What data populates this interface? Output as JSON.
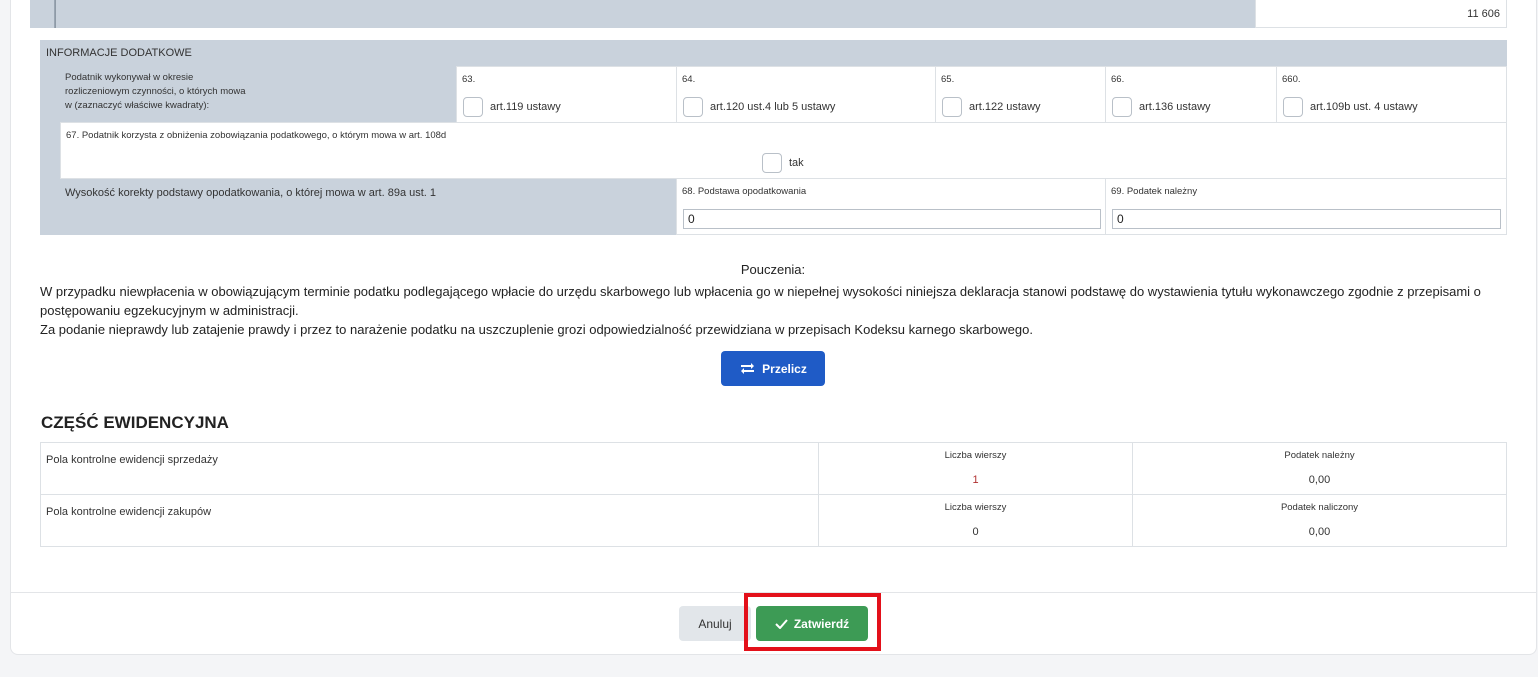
{
  "top_row": {
    "value": "11 606"
  },
  "info": {
    "header": "INFORMACJE DODATKOWE",
    "activities_label": "Podatnik wykonywał w okresie rozliczeniowym czynności, o których mowa w (zaznaczyć właściwe kwadraty):",
    "checkboxes": [
      {
        "num": "63.",
        "label": "art.119 ustawy"
      },
      {
        "num": "64.",
        "label": "art.120 ust.4 lub 5 ustawy"
      },
      {
        "num": "65.",
        "label": "art.122 ustawy"
      },
      {
        "num": "66.",
        "label": "art.136 ustawy"
      },
      {
        "num": "660.",
        "label": "art.109b ust. 4 ustawy"
      }
    ],
    "field67": {
      "label": "67. Podatnik korzysta z obniżenia zobowiązania podatkowego, o którym mowa w art. 108d",
      "option": "tak"
    },
    "correction_label": "Wysokość korekty podstawy opodatkowania, o której mowa w art. 89a ust. 1",
    "field68": {
      "label": "68. Podstawa opodatkowania",
      "value": "0"
    },
    "field69": {
      "label": "69. Podatek należny",
      "value": "0"
    }
  },
  "instructions": {
    "title": "Pouczenia:",
    "line1": "W przypadku niewpłacenia w obowiązującym terminie podatku podlegającego wpłacie do urzędu skarbowego lub wpłacenia go w niepełnej wysokości niniejsza deklaracja stanowi podstawę do wystawienia tytułu wykonawczego zgodnie z przepisami o postępowaniu egzekucyjnym w administracji.",
    "line2": "Za podanie nieprawdy lub zatajenie prawdy i przez to narażenie podatku na uszczuplenie grozi odpowiedzialność przewidziana w przepisach Kodeksu karnego skarbowego."
  },
  "recalc_button": {
    "label": "Przelicz",
    "icon": "refresh-arrows-icon"
  },
  "records": {
    "title": "CZĘŚĆ EWIDENCYJNA",
    "rows": [
      {
        "label": "Pola kontrolne ewidencji sprzedaży",
        "col1_head": "Liczba wierszy",
        "col1_value": "1",
        "col2_head": "Podatek należny",
        "col2_value": "0,00"
      },
      {
        "label": "Pola kontrolne ewidencji zakupów",
        "col1_head": "Liczba wierszy",
        "col1_value": "0",
        "col2_head": "Podatek naliczony",
        "col2_value": "0,00"
      }
    ]
  },
  "footer": {
    "cancel_label": "Anuluj",
    "confirm_label": "Zatwierdź",
    "confirm_icon": "checkmark-icon",
    "highlight_color": "#e3101a"
  },
  "colors": {
    "primary": "#1f5bc6",
    "success": "#3d9b55",
    "header_gray": "#c9d2dc"
  }
}
